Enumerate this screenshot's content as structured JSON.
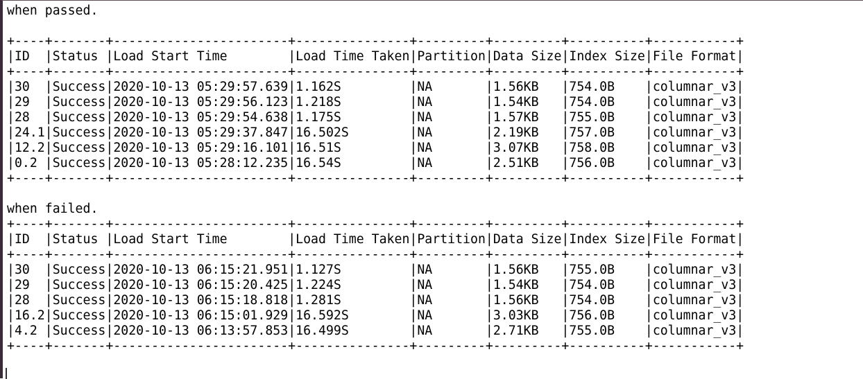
{
  "sections": [
    {
      "label": "when passed.",
      "columns": [
        "ID",
        "Status",
        "Load Start Time",
        "Load Time Taken",
        "Partition",
        "Data Size",
        "Index Size",
        "File Format"
      ],
      "rows": [
        [
          "30",
          "Success",
          "2020-10-13 05:29:57.639",
          "1.162S",
          "NA",
          "1.56KB",
          "754.0B",
          "columnar_v3"
        ],
        [
          "29",
          "Success",
          "2020-10-13 05:29:56.123",
          "1.218S",
          "NA",
          "1.54KB",
          "754.0B",
          "columnar_v3"
        ],
        [
          "28",
          "Success",
          "2020-10-13 05:29:54.638",
          "1.175S",
          "NA",
          "1.57KB",
          "755.0B",
          "columnar_v3"
        ],
        [
          "24.1",
          "Success",
          "2020-10-13 05:29:37.847",
          "16.502S",
          "NA",
          "2.19KB",
          "757.0B",
          "columnar_v3"
        ],
        [
          "12.2",
          "Success",
          "2020-10-13 05:29:16.101",
          "16.51S",
          "NA",
          "3.07KB",
          "758.0B",
          "columnar_v3"
        ],
        [
          "0.2",
          "Success",
          "2020-10-13 05:28:12.235",
          "16.54S",
          "NA",
          "2.51KB",
          "756.0B",
          "columnar_v3"
        ]
      ]
    },
    {
      "label": "when failed.",
      "columns": [
        "ID",
        "Status",
        "Load Start Time",
        "Load Time Taken",
        "Partition",
        "Data Size",
        "Index Size",
        "File Format"
      ],
      "rows": [
        [
          "30",
          "Success",
          "2020-10-13 06:15:21.951",
          "1.127S",
          "NA",
          "1.56KB",
          "755.0B",
          "columnar_v3"
        ],
        [
          "29",
          "Success",
          "2020-10-13 06:15:20.425",
          "1.224S",
          "NA",
          "1.54KB",
          "754.0B",
          "columnar_v3"
        ],
        [
          "28",
          "Success",
          "2020-10-13 06:15:18.818",
          "1.281S",
          "NA",
          "1.56KB",
          "754.0B",
          "columnar_v3"
        ],
        [
          "16.2",
          "Success",
          "2020-10-13 06:15:01.929",
          "16.592S",
          "NA",
          "3.03KB",
          "756.0B",
          "columnar_v3"
        ],
        [
          "4.2",
          "Success",
          "2020-10-13 06:13:57.853",
          "16.499S",
          "NA",
          "2.71KB",
          "755.0B",
          "columnar_v3"
        ]
      ]
    }
  ]
}
